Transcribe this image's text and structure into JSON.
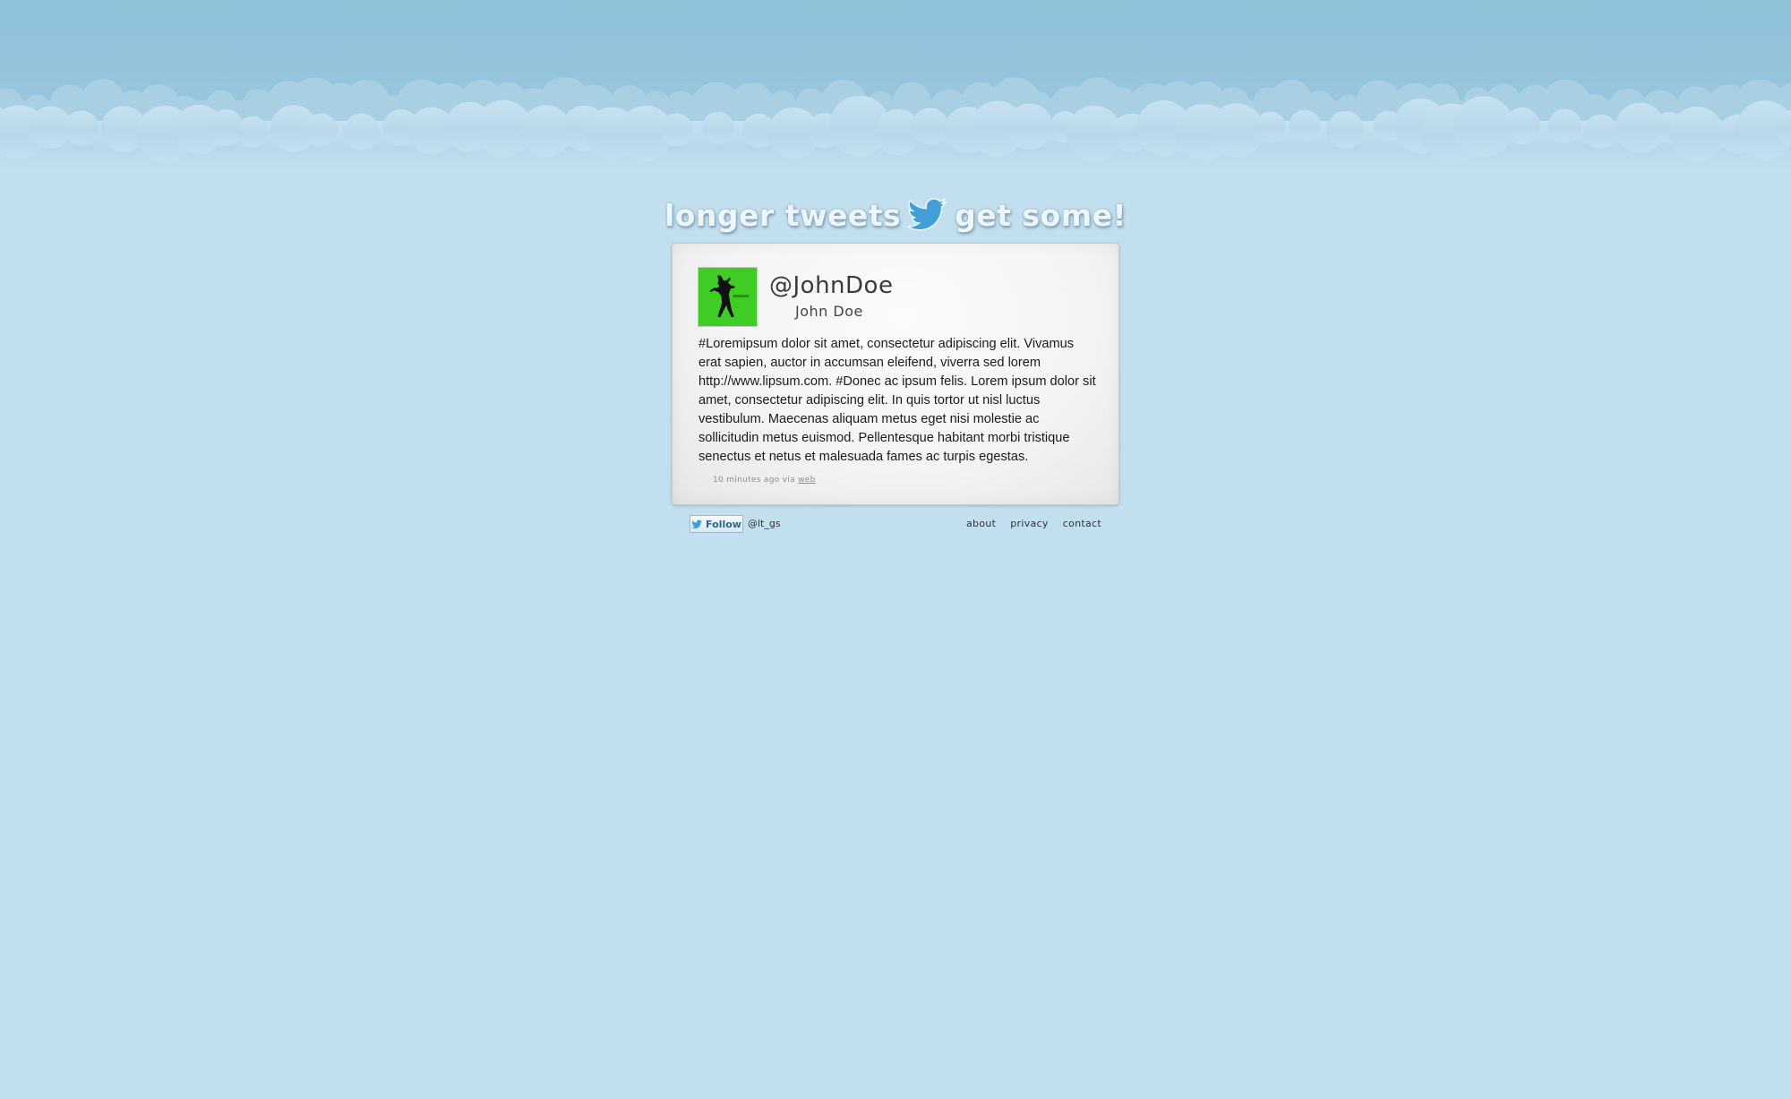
{
  "brand": {
    "left_text": "longer tweets",
    "right_text": "get some!",
    "bird_icon": "twitter-bird-icon"
  },
  "colors": {
    "background": "#c2dfef",
    "sky": "#92c2db",
    "cloud": "#b3d5e8",
    "card": "#f4f4f4",
    "avatar": "#3fcc24",
    "bird": "#3f9fd6"
  },
  "tweet": {
    "avatar_icon": "user-avatar-silhouette",
    "handle": "@JohnDoe",
    "name": "John Doe",
    "text": "#Loremipsum dolor sit amet, consectetur adipiscing elit. Vivamus erat sapien, auctor in accumsan eleifend, viverra sed lorem http://www.lipsum.com. #Donec ac ipsum felis. Lorem ipsum dolor sit amet, consectetur adipiscing elit. In quis tortor ut nisl luctus vestibulum. Maecenas aliquam metus eget nisi molestie ac sollicitudin metus euismod. Pellentesque habitant morbi tristique senectus et netus et malesuada fames ac turpis egestas.",
    "timestamp": "10 minutes ago via",
    "source_link": "web"
  },
  "footer": {
    "follow_label": "Follow",
    "follow_handle": "@lt_gs",
    "links": [
      "about",
      "privacy",
      "contact"
    ]
  }
}
